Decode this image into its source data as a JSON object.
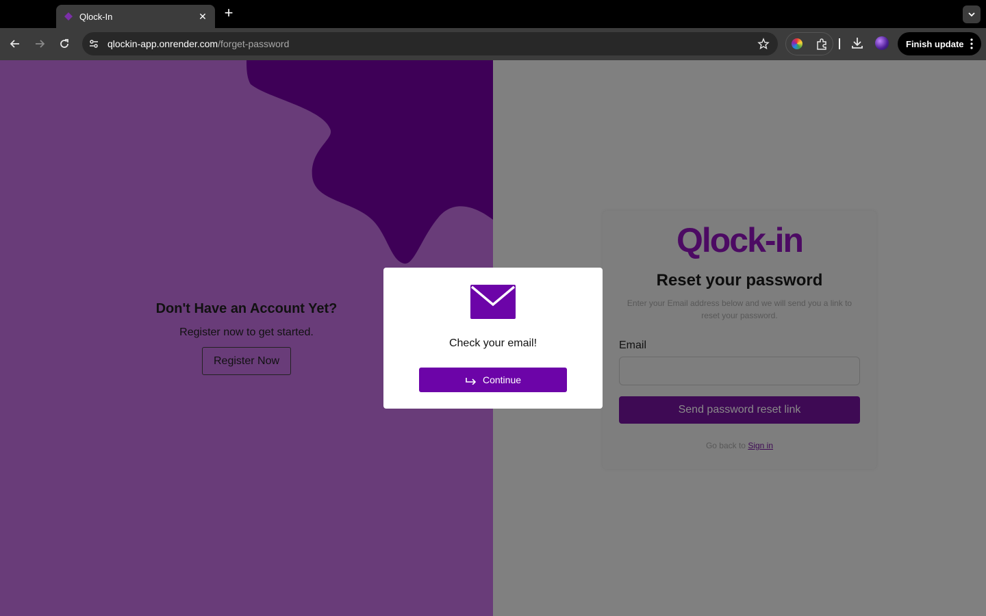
{
  "browser": {
    "tab_title": "Qlock-In",
    "url_host": "qlockin-app.onrender.com",
    "url_path": "/forget-password",
    "finish_update_label": "Finish update"
  },
  "left": {
    "heading": "Don't Have an Account Yet?",
    "subtext": "Register now to get started.",
    "register_label": "Register Now"
  },
  "card": {
    "brand": "Qlock-in",
    "title": "Reset your password",
    "description": "Enter your Email address below and we will send you a link to reset your password.",
    "email_label": "Email",
    "email_value": "",
    "send_label": "Send password reset link",
    "goback_text": "Go back to",
    "signin_label": "Sign in"
  },
  "modal": {
    "message": "Check your email!",
    "continue_label": "Continue"
  },
  "colors": {
    "accent": "#6c04a8",
    "left_bg": "#693c79",
    "blob": "#3e0057",
    "brand": "#4c0a63"
  }
}
